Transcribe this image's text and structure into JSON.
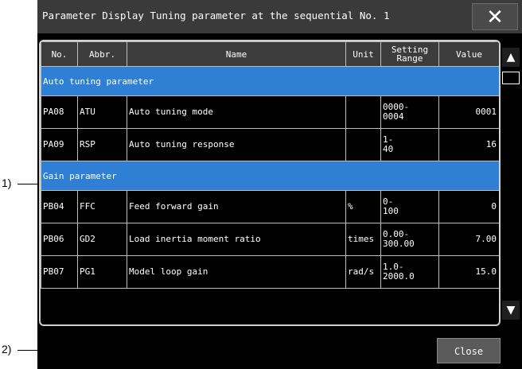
{
  "window": {
    "title": "Parameter Display  Tuning parameter at the sequential No. 1",
    "close_icon": "close-x-icon",
    "close_button_label": "Close"
  },
  "table": {
    "headers": [
      "No.",
      "Abbr.",
      "Name",
      "Unit",
      "Setting Range",
      "Value"
    ],
    "sections": [
      {
        "title": "Auto tuning parameter",
        "rows": [
          {
            "no": "PA08",
            "abbr": "ATU",
            "name": "Auto tuning mode",
            "unit": "",
            "range_line1": "0000-",
            "range_line2": "0004",
            "value": "0001"
          },
          {
            "no": "PA09",
            "abbr": "RSP",
            "name": "Auto tuning response",
            "unit": "",
            "range_line1": "1-",
            "range_line2": "40",
            "value": "16"
          }
        ]
      },
      {
        "title": "Gain parameter",
        "rows": [
          {
            "no": "PB04",
            "abbr": "FFC",
            "name": "Feed forward gain",
            "unit": "%",
            "range_line1": "0-",
            "range_line2": "100",
            "value": "0"
          },
          {
            "no": "PB06",
            "abbr": "GD2",
            "name": "Load inertia moment ratio",
            "unit": "times",
            "range_line1": "0.00-",
            "range_line2": "300.00",
            "value": "7.00"
          },
          {
            "no": "PB07",
            "abbr": "PG1",
            "name": "Model loop gain",
            "unit": "rad/s",
            "range_line1": "1.0-",
            "range_line2": "2000.0",
            "value": "15.0"
          }
        ]
      }
    ]
  },
  "scrollbar": {
    "up_icon": "triangle-up-icon",
    "down_icon": "triangle-down-icon"
  },
  "callouts": [
    "1)",
    "2)"
  ]
}
